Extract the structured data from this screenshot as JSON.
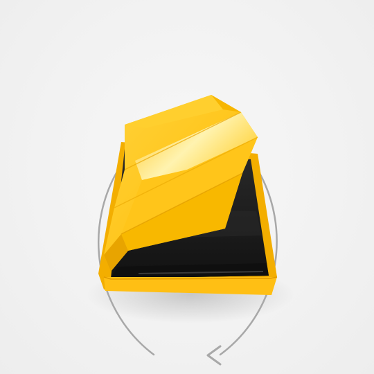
{
  "scene": {
    "subject": "yellow-and-black-3d-object",
    "rotation_indicator": {
      "direction": "counterclockwise",
      "icon": "rotate-arrow-icon"
    },
    "colors": {
      "background": "#f2f2f2",
      "yellow": "#ffc21a",
      "yellow_dark": "#f0a800",
      "black": "#1c1c1c",
      "arrow": "#a8a8a8"
    }
  }
}
